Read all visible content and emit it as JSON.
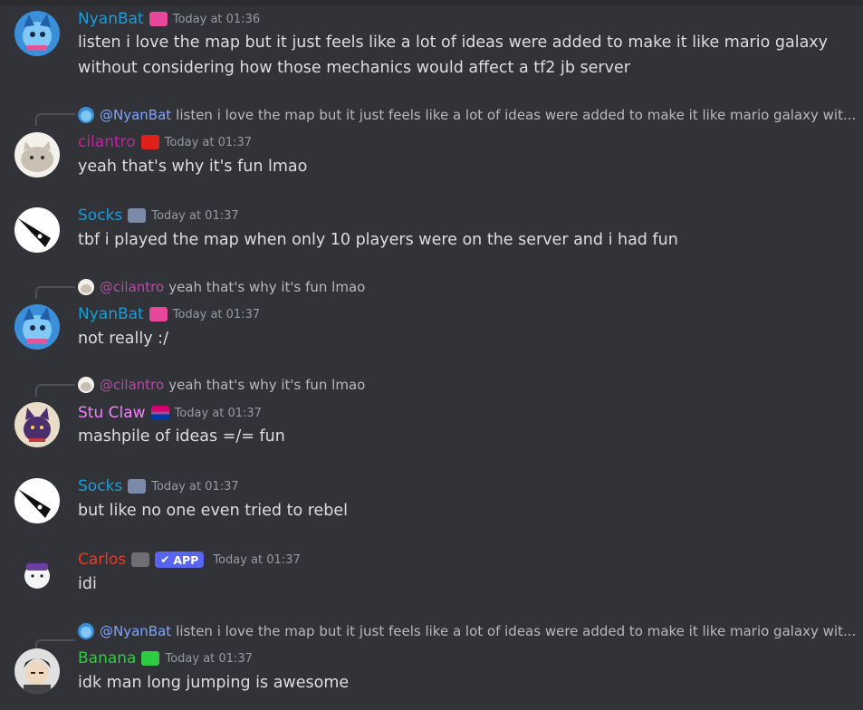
{
  "messages": [
    {
      "author": "NyanBat",
      "author_color": "#1a9cd9",
      "timestamp": "Today at 01:36",
      "text": "listen i love the map but it just feels like a lot of ideas were added to make it like mario galaxy",
      "text2": "without considering how those mechanics would affect a tf2 jb server"
    },
    {
      "reply": {
        "mention": "@NyanBat",
        "preview": "listen i love the map but it just feels like a lot of ideas were added to make it like mario galaxy wit..."
      },
      "author": "cilantro",
      "author_color": "#c1249e",
      "timestamp": "Today at 01:37",
      "text": "yeah that's why it's fun lmao"
    },
    {
      "author": "Socks",
      "author_color": "#1a9cd9",
      "timestamp": "Today at 01:37",
      "text": "tbf i played the map when only 10 players were on the server and i had fun"
    },
    {
      "reply": {
        "mention": "@cilantro",
        "preview": "yeah that's why it's fun lmao"
      },
      "author": "NyanBat",
      "author_color": "#1a9cd9",
      "timestamp": "Today at 01:37",
      "text": "not really :/"
    },
    {
      "reply": {
        "mention": "@cilantro",
        "preview": "yeah that's why it's fun lmao"
      },
      "author": "Stu Claw",
      "author_color": "#f47fff",
      "timestamp": "Today at 01:37",
      "text": "mashpile of ideas =/= fun"
    },
    {
      "author": "Socks",
      "author_color": "#1a9cd9",
      "timestamp": "Today at 01:37",
      "text": "but like no one even tried to rebel"
    },
    {
      "author": "Carlos",
      "author_color": "#e23e28",
      "badge": "APP",
      "timestamp": "Today at 01:37",
      "text": "idi"
    },
    {
      "reply": {
        "mention": "@NyanBat",
        "preview": "listen i love the map but it just feels like a lot of ideas were added to make it like mario galaxy wit..."
      },
      "author": "Banana",
      "author_color": "#2ecc40",
      "timestamp": "Today at 01:37",
      "text": "idk man long jumping is awesome"
    }
  ],
  "colors": {
    "background": "#313338",
    "mention_nyanbat": "#7da4ff",
    "mention_cilantro": "#b04fa0",
    "app_badge": "#5865f2"
  }
}
